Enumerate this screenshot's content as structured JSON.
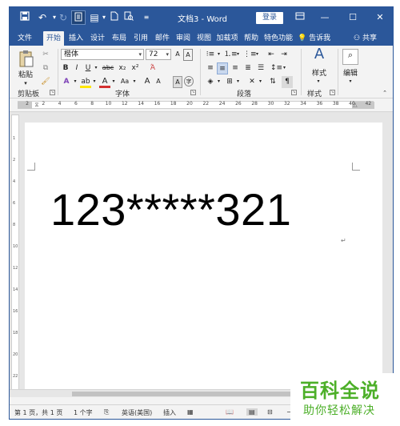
{
  "titlebar": {
    "save_icon": "save-icon",
    "undo_icon": "undo-icon",
    "redo_icon": "redo-icon",
    "doc_title": "文档3 - Word",
    "login_label": "登录",
    "minimize": "—",
    "restore": "☐",
    "close": "✕"
  },
  "tabs": {
    "items": [
      "文件",
      "开始",
      "插入",
      "设计",
      "布局",
      "引用",
      "邮件",
      "审阅",
      "视图",
      "加载项",
      "帮助",
      "特色功能"
    ],
    "active": "开始",
    "tell_me": "告诉我",
    "share": "共享"
  },
  "ribbon": {
    "clipboard": {
      "paste_label": "粘贴",
      "group_label": "剪贴板"
    },
    "font": {
      "font_name": "楷体",
      "font_size": "72",
      "group_label": "字体",
      "bold": "B",
      "italic": "I",
      "underline": "U",
      "strike": "abc",
      "subscript": "x₂",
      "superscript": "x²",
      "font_color": "A",
      "case": "Aa",
      "grow": "A",
      "shrink": "A"
    },
    "paragraph": {
      "group_label": "段落"
    },
    "styles": {
      "label": "样式",
      "group_label": "样式"
    },
    "editing": {
      "label": "编辑"
    }
  },
  "ruler": {
    "numbers": [
      "2",
      "2",
      "4",
      "6",
      "8",
      "10",
      "12",
      "14",
      "16",
      "18",
      "20",
      "22",
      "24",
      "26",
      "28",
      "30",
      "32",
      "34",
      "36",
      "38",
      "40",
      "42"
    ]
  },
  "vruler": {
    "numbers": [
      "1",
      "2",
      "4",
      "6",
      "8",
      "10",
      "12",
      "14",
      "16",
      "18",
      "20",
      "22"
    ]
  },
  "document": {
    "text": "123*****321",
    "para_mark": "↵"
  },
  "statusbar": {
    "page": "第 1 页，共 1 页",
    "words": "1 个字",
    "language": "英语(美国)",
    "mode": "插入"
  },
  "watermark": {
    "top": "百科全说",
    "bottom": "助你轻松解决"
  },
  "colors": {
    "accent": "#2b579a",
    "watermark": "#4caf28"
  }
}
